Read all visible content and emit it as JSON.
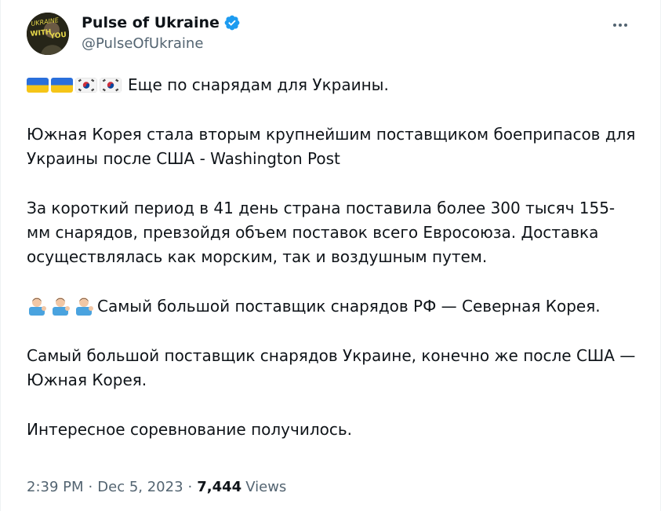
{
  "author": {
    "display_name": "Pulse of Ukraine",
    "handle": "@PulseOfUkraine",
    "verified": true,
    "avatar_text": "UKRAINE BEGINS WITH YOU"
  },
  "tweet": {
    "line1": "Еще по снарядам для Украины.",
    "para2": "Южная Корея стала вторым крупнейшим поставщиком боеприпасов для Украины после США - Washington Post",
    "para3": "За короткий период в 41 день страна поставила более 300 тысяч 155-мм снарядов, превзойдя объем поставок всего Евросоюза. Доставка осуществлялась как морским, так и воздушным путем.",
    "para4": "Самый большой поставщик снарядов РФ — Северная Корея.",
    "para5": "Самый большой поставщик снарядов Украине, конечно же после США — Южная Корея.",
    "para6": "Интересное соревнование получилось."
  },
  "meta": {
    "time": "2:39 PM",
    "separator": "·",
    "date": "Dec 5, 2023",
    "views_count": "7,444",
    "views_label": "Views"
  },
  "icons": {
    "more": "more-horizontal-icon",
    "verified": "verified-badge-icon",
    "flag_ua": "flag-ukraine-icon",
    "flag_kr": "flag-south-korea-icon",
    "man_shrug": "man-tipping-hand-icon"
  },
  "colors": {
    "text": "#0f1419",
    "secondary": "#536471",
    "verified": "#1d9bf0",
    "ua_blue": "#2a6fdb",
    "ua_yellow": "#f5c518"
  }
}
